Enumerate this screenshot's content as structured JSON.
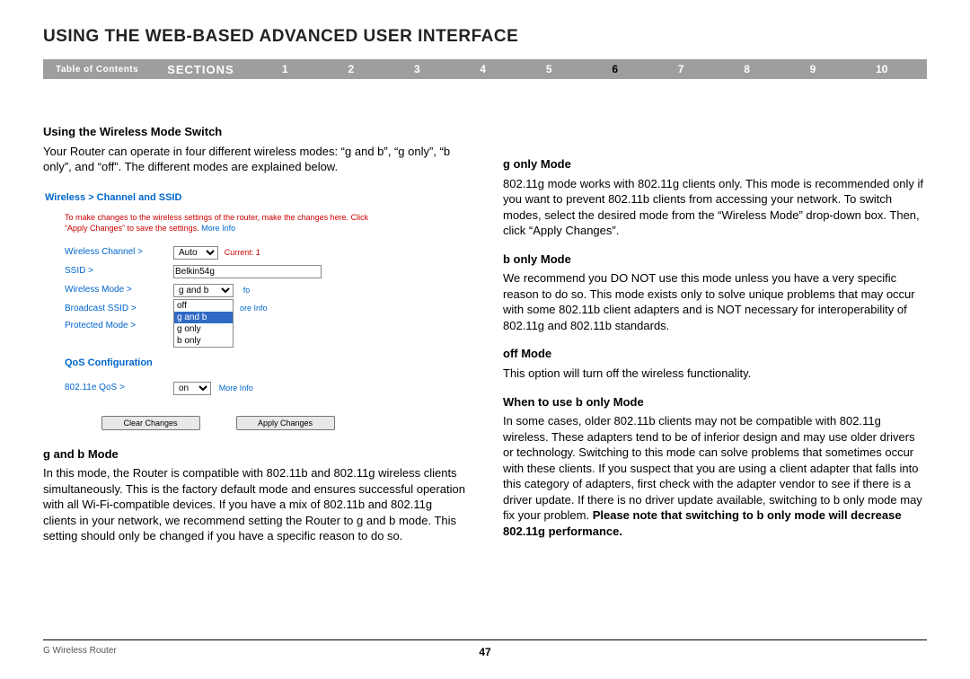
{
  "title": "USING THE WEB-BASED ADVANCED USER INTERFACE",
  "nav": {
    "toc": "Table of Contents",
    "sections_label": "SECTIONS",
    "items": [
      "1",
      "2",
      "3",
      "4",
      "5",
      "6",
      "7",
      "8",
      "9",
      "10"
    ],
    "active": "6"
  },
  "left": {
    "h1": "Using the Wireless Mode Switch",
    "p1": "Your Router can operate in four different wireless modes: “g and b”, “g only”, “b only”, and “off”. The different modes are explained below.",
    "shot": {
      "breadcrumb": "Wireless > Channel and SSID",
      "note_a": "To make changes to the wireless settings of the router, make the changes here. Click “Apply Changes” to save the settings. ",
      "note_more": "More Info",
      "rows": {
        "channel_label": "Wireless Channel >",
        "channel_value": "Auto",
        "channel_current": "Current: 1",
        "ssid_label": "SSID >",
        "ssid_value": "Belkin54g",
        "mode_label": "Wireless Mode >",
        "mode_value": "g and b",
        "mode_options": [
          "off",
          "g and b",
          "g only",
          "b only"
        ],
        "broadcast_label": "Broadcast SSID >",
        "broadcast_more": "fo",
        "protected_label": "Protected Mode >",
        "protected_more": "ore Info"
      },
      "qos_head": "QoS Configuration",
      "qos_label": "802.11e QoS >",
      "qos_value": "on",
      "qos_more": "More Info",
      "btn_clear": "Clear Changes",
      "btn_apply": "Apply Changes"
    },
    "h2": "g and b Mode",
    "p2": "In this mode, the Router is compatible with 802.11b and 802.11g wireless clients simultaneously. This is the factory default mode and ensures successful operation with all Wi-Fi-compatible devices. If you have a mix of 802.11b and 802.11g clients in your network, we recommend setting the Router to g and b mode. This setting should only be changed if you have a specific reason to do so."
  },
  "right": {
    "h1": "g only Mode",
    "p1": "802.11g mode works with 802.11g clients only. This mode is recommended only if you want to prevent 802.11b clients from accessing your network. To switch modes, select the desired mode from the “Wireless Mode” drop-down box. Then, click “Apply Changes”.",
    "h2": "b only Mode",
    "p2": "We recommend you DO NOT use this mode unless you have a very specific reason to do so. This mode exists only to solve unique problems that may occur with some 802.11b client adapters and is NOT necessary for interoperability of 802.11g and 802.11b standards.",
    "h3": "off Mode",
    "p3": "This option will turn off the wireless functionality.",
    "h4": "When to use b only Mode",
    "p4a": "In some cases, older 802.11b clients may not be compatible with 802.11g wireless. These adapters tend to be of inferior design and may use older drivers or technology. Switching to this mode can solve problems that sometimes occur with these clients. If you suspect that you are using a client adapter that falls into this category of adapters, first check with the adapter vendor to see if there is a driver update. If there is no driver update available, switching to b only mode may fix your problem. ",
    "p4b": "Please note that switching to b only mode will decrease 802.11g performance."
  },
  "footer": {
    "product": "G Wireless Router",
    "page": "47"
  }
}
